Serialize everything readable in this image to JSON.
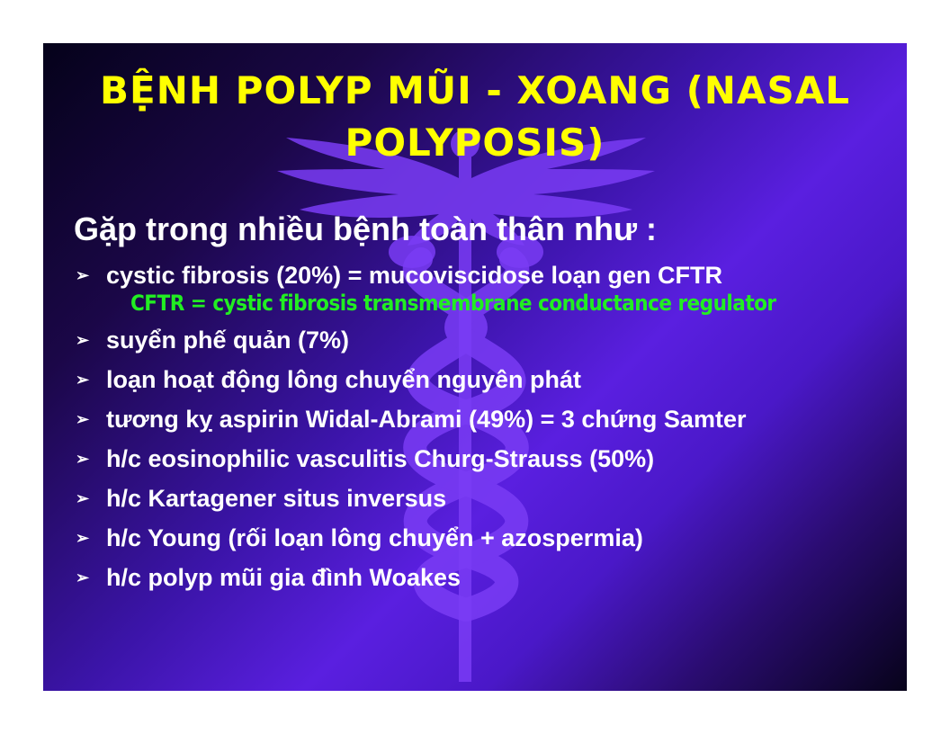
{
  "slide": {
    "title_lines": [
      "BỆNH POLYP MŨI - XOANG (NASAL",
      "POLYPOSIS)"
    ],
    "lead": "Gặp trong nhiều bệnh toàn thân như :",
    "bullet_glyph": "➢",
    "items": [
      {
        "text": "cystic fibrosis (20%) = mucoviscidose loạn gen CFTR",
        "sub": "CFTR = cystic fibrosis transmembrane conductance regulator"
      },
      {
        "text": "suyển phế quản (7%)"
      },
      {
        "text": "loạn hoạt động lông chuyển nguyên phát"
      },
      {
        "text": "tương kỵ aspirin Widal-Abrami (49%) = 3 chứng Samter"
      },
      {
        "text": "h/c eosinophilic vasculitis Churg-Strauss (50%)"
      },
      {
        "text": "h/c Kartagener  situs inversus"
      },
      {
        "text": "h/c Young (rối loạn lông chuyển + azospermia)"
      },
      {
        "text": "h/c polyp mũi gia đình Woakes"
      }
    ],
    "colors": {
      "title": "#ffff00",
      "body": "#ffffff",
      "highlight": "#22ee22",
      "background_center": "#5a1fe0",
      "background_edge": "#05021a",
      "emblem": "#7a3cf5"
    },
    "emblem_icon": "caduceus-icon"
  }
}
